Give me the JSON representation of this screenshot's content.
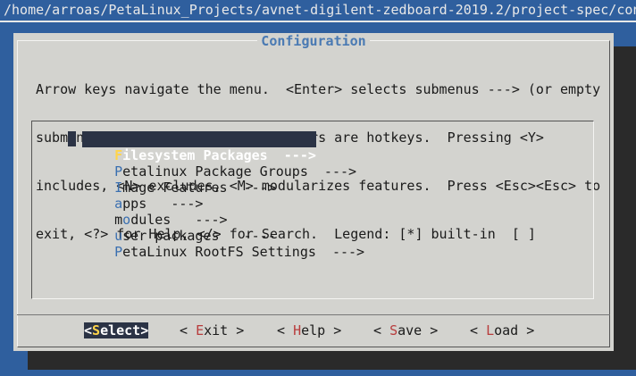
{
  "terminal": {
    "path": "/home/arroas/PetaLinux_Projects/avnet-digilent-zedboard-2019.2/project-spec/con"
  },
  "dialog": {
    "title": "Configuration",
    "help_lines": [
      "Arrow keys navigate the menu.  <Enter> selects submenus ---> (or empty",
      "submenus ----).  Highlighted letters are hotkeys.  Pressing <Y>",
      "includes, <N> excludes, <M> modularizes features.  Press <Esc><Esc> to",
      "exit, <?> for Help, </> for Search.  Legend: [*] built-in  [ ]"
    ]
  },
  "menu": {
    "items": [
      {
        "hotkey": "F",
        "rest": "ilesystem Packages  --->",
        "pre": "",
        "selected": true
      },
      {
        "hotkey": "P",
        "rest": "etalinux Package Groups  --->",
        "pre": "",
        "selected": false
      },
      {
        "hotkey": "I",
        "rest": "mage Features  --->",
        "pre": "",
        "selected": false
      },
      {
        "hotkey": "a",
        "rest": "pps   --->",
        "pre": "",
        "selected": false
      },
      {
        "hotkey": "o",
        "rest": "dules   --->",
        "pre": "m",
        "selected": false
      },
      {
        "hotkey": "u",
        "rest": "ser packages   ----",
        "pre": "",
        "selected": false
      },
      {
        "hotkey": "P",
        "rest": "etaLinux RootFS Settings  --->",
        "pre": "",
        "selected": false
      }
    ]
  },
  "buttons": [
    {
      "left": "<",
      "hotkey": "S",
      "rest": "elect",
      "right": ">",
      "selected": true
    },
    {
      "left": "< ",
      "hotkey": "E",
      "rest": "xit",
      "right": " >",
      "selected": false
    },
    {
      "left": "< ",
      "hotkey": "H",
      "rest": "elp",
      "right": " >",
      "selected": false
    },
    {
      "left": "< ",
      "hotkey": "S",
      "rest": "ave",
      "right": " >",
      "selected": false
    },
    {
      "left": "< ",
      "hotkey": "L",
      "rest": "oad",
      "right": " >",
      "selected": false
    }
  ],
  "colors": {
    "background": "#2f5f9e",
    "dialog": "#d3d3cf",
    "title": "#4a7ab3",
    "selection": "#2b3345",
    "selected_hotkey": "#ffd44a",
    "button_hotkey": "#b83c3c"
  }
}
